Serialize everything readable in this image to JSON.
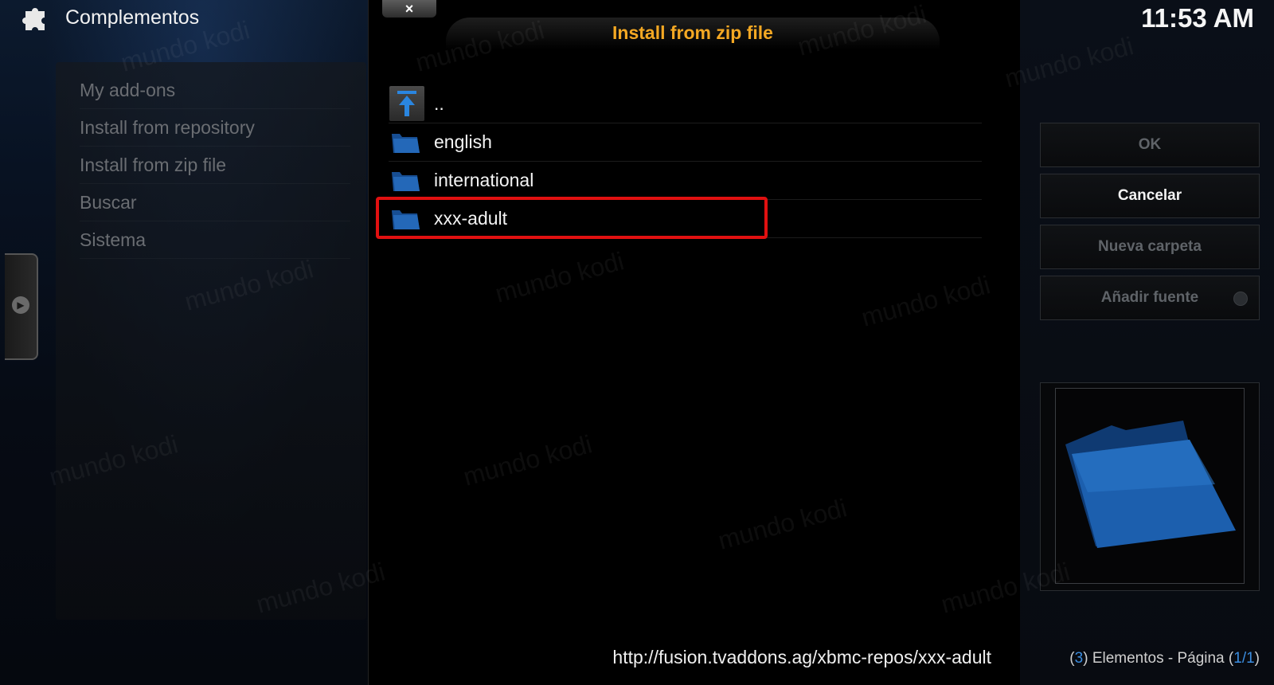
{
  "header": {
    "section_title": "Complementos",
    "clock": "11:53 AM"
  },
  "menu": {
    "items": [
      {
        "label": "My add-ons"
      },
      {
        "label": "Install from repository"
      },
      {
        "label": "Install from zip file"
      },
      {
        "label": "Buscar"
      },
      {
        "label": "Sistema"
      }
    ]
  },
  "dialog": {
    "close_label": "×",
    "title": "Install from zip file",
    "files": [
      {
        "label": "..",
        "icon": "parent-folder-icon"
      },
      {
        "label": "english",
        "icon": "folder-icon"
      },
      {
        "label": "international",
        "icon": "folder-icon"
      },
      {
        "label": "xxx-adult",
        "icon": "folder-icon",
        "highlighted": true
      }
    ],
    "path": "http://fusion.tvaddons.ag/xbmc-repos/xxx-adult"
  },
  "actions": {
    "ok": "OK",
    "cancel": "Cancelar",
    "new_folder": "Nueva carpeta",
    "add_source": "Añadir fuente"
  },
  "status": {
    "count": "3",
    "items_label": "Elementos - Página",
    "page": "1/1"
  },
  "watermark_text": "mundo kodi",
  "colors": {
    "title_accent": "#f4a823",
    "highlight_border": "#e01010",
    "status_number": "#3b8de0",
    "folder_blue": "#1c5fae"
  }
}
